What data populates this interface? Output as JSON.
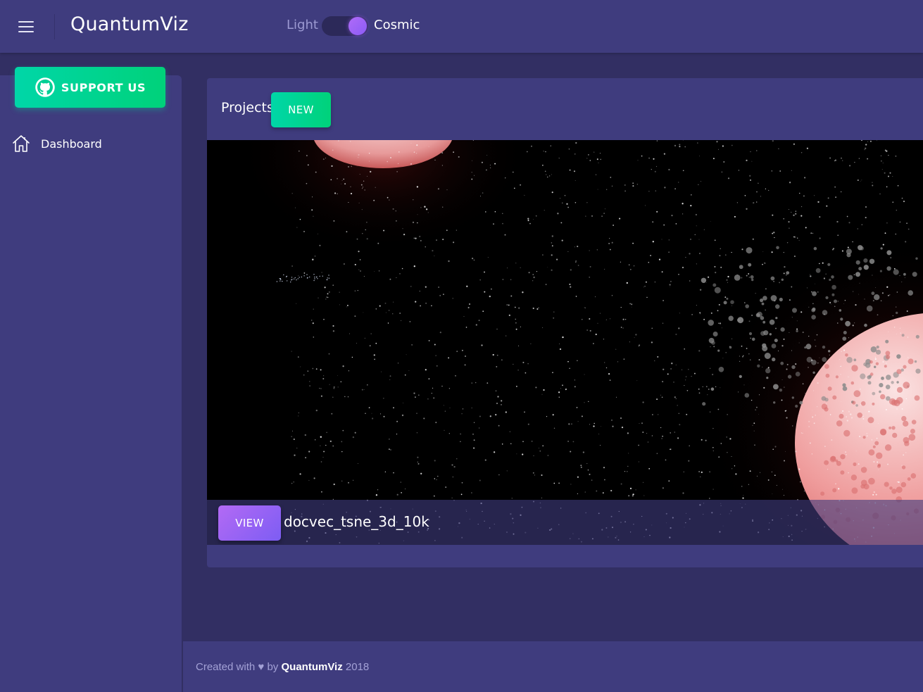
{
  "header": {
    "menu_icon": "hamburger-icon",
    "brand": "QuantumViz",
    "theme_light_label": "Light",
    "theme_cosmic_label": "Cosmic",
    "theme_selected": "Cosmic"
  },
  "sidebar": {
    "support_button": {
      "icon": "github-icon",
      "label": "SUPPORT US"
    },
    "items": [
      {
        "icon": "home-icon",
        "label": "Dashboard"
      }
    ]
  },
  "main": {
    "card_title": "Projects",
    "new_button_label": "NEW",
    "projects": [
      {
        "view_label": "VIEW",
        "name": "docvec_tsne_3d_10k"
      }
    ]
  },
  "footer": {
    "prefix": "Created with",
    "heart": "♥",
    "by": "by",
    "brand": "QuantumViz",
    "year": "2018"
  },
  "colors": {
    "background": "#322f63",
    "panel": "#3f3c7e",
    "accent_green": "#00d6a8",
    "accent_purple": "#a066f5"
  }
}
